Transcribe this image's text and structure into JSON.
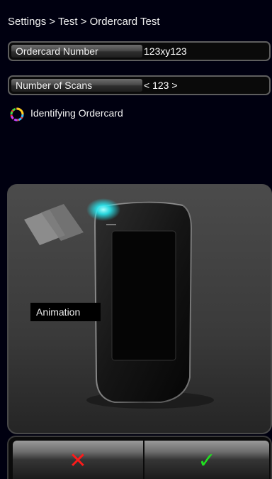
{
  "breadcrumb": "Settings > Test > Ordercard Test",
  "fields": [
    {
      "label": "Ordercard Number",
      "value": "123xy123"
    },
    {
      "label": "Number of Scans",
      "value": "< 123 >"
    }
  ],
  "status": {
    "text": "Identifying Ordercard",
    "icon": "loading-spinner-icon"
  },
  "animation": {
    "label": "Animation",
    "accent": "#28e8f0"
  },
  "buttons": {
    "cancel": {
      "glyph": "✕",
      "icon": "cancel-x-icon",
      "color": "#ff1a1a"
    },
    "confirm": {
      "glyph": "✓",
      "icon": "checkmark-icon",
      "color": "#20e020"
    }
  }
}
